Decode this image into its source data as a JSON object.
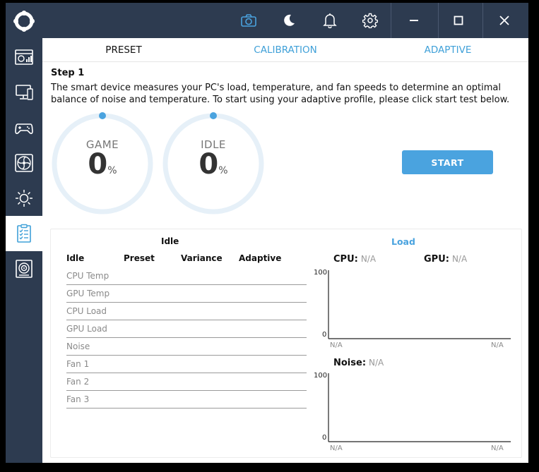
{
  "tabs": [
    {
      "label": "PRESET"
    },
    {
      "label": "CALIBRATION"
    },
    {
      "label": "ADAPTIVE"
    }
  ],
  "step": {
    "title": "Step 1",
    "description": "The smart device measures your PC's load, temperature, and fan speeds to determine an optimal balance of noise and temperature. To start using your adaptive profile, please click start test below."
  },
  "gauges": [
    {
      "label": "GAME",
      "value": "0",
      "unit": "%",
      "progress": 0
    },
    {
      "label": "IDLE",
      "value": "0",
      "unit": "%",
      "progress": 0
    }
  ],
  "start_label": "START",
  "panel": {
    "idle_title": "Idle",
    "load_title": "Load",
    "columns": [
      "Idle",
      "Preset",
      "Variance",
      "Adaptive"
    ],
    "rows": [
      "CPU Temp",
      "GPU Temp",
      "CPU Load",
      "GPU Load",
      "Noise",
      "Fan 1",
      "Fan 2",
      "Fan 3"
    ],
    "cpu_label": "CPU:",
    "cpu_value": "N/A",
    "gpu_label": "GPU:",
    "gpu_value": "N/A",
    "noise_label": "Noise:",
    "noise_value": "N/A",
    "chart_top": {
      "ymax": "100",
      "ymin": "0",
      "x_left": "N/A",
      "x_right": "N/A"
    },
    "chart_bottom": {
      "ymax": "100",
      "ymin": "0",
      "x_left": "N/A",
      "x_right": "N/A"
    }
  },
  "colors": {
    "accent": "#4aa3df",
    "sidebar": "#2d3b50",
    "gauge_track": "#e6f0f8"
  },
  "icons": {
    "sidebar": [
      "dashboard-icon",
      "monitor-icon",
      "gamepad-icon",
      "fan-icon",
      "lighting-icon",
      "checklist-icon",
      "device-icon"
    ],
    "titlebar": [
      "camera-icon",
      "moon-icon",
      "bell-icon",
      "gear-icon",
      "minimize-icon",
      "maximize-icon",
      "close-icon"
    ]
  }
}
